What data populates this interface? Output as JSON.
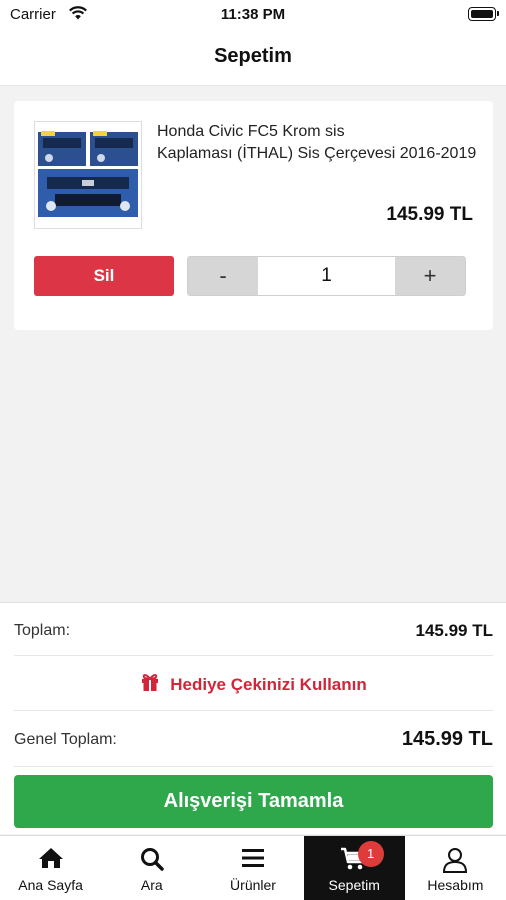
{
  "status_bar": {
    "carrier": "Carrier",
    "time": "11:38 PM"
  },
  "header": {
    "title": "Sepetim"
  },
  "cart": {
    "items": [
      {
        "name_line1": "Honda Civic FC5 Krom sis",
        "name_line2": "Kaplaması (İTHAL) Sis Çerçevesi 2016-2019",
        "price": "145.99 TL",
        "quantity": "1",
        "delete_label": "Sil",
        "minus_label": "-",
        "plus_label": "+"
      }
    ]
  },
  "summary": {
    "total_label": "Toplam:",
    "total_value": "145.99 TL",
    "gift_label": "Hediye Çekinizi Kullanın",
    "grand_total_label": "Genel Toplam:",
    "grand_total_value": "145.99 TL",
    "checkout_label": "Alışverişi Tamamla"
  },
  "tabs": [
    {
      "label": "Ana Sayfa",
      "icon": "home-icon"
    },
    {
      "label": "Ara",
      "icon": "search-icon"
    },
    {
      "label": "Ürünler",
      "icon": "menu-icon"
    },
    {
      "label": "Sepetim",
      "icon": "cart-icon",
      "badge": "1",
      "active": true
    },
    {
      "label": "Hesabım",
      "icon": "user-icon"
    }
  ],
  "colors": {
    "danger": "#dc3545",
    "success": "#2ea84a",
    "gift_red": "#d0263a",
    "active_tab": "#111111",
    "badge": "#e03b3b"
  }
}
